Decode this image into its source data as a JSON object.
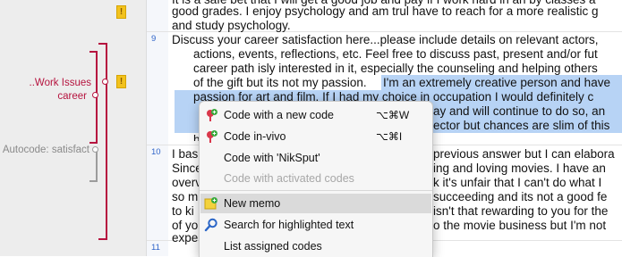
{
  "codes": {
    "parent_label": "..Work Issues",
    "child_label": "career",
    "autocode_label": "Autocode: satisfact",
    "memo_flag_glyph": "!"
  },
  "line_numbers": [
    "9",
    "10",
    "11"
  ],
  "document_lines": [
    "It is a safe bet that I will get a good job and pay if I work hard in an by classes a",
    "good grades. I enjoy psychology and am trul have to reach for a more realistic g",
    "and study psychology.",
    "Discuss your career satisfaction here...please include details on relevant actors,",
    "actions, events, reflections, etc. Feel free to discuss past, present and/or fut",
    "career path isly interested in it, especially the counseling and helping others",
    "of the gift but its not my passion. ",
    "I'm an extremely creative person and have",
    "passion for art and film. If I had my choice in occupation I would definitely c",
    "ay and will continue to do so, an",
    "ector but chances are slim of this",
    "h",
    "I bas",
    "previous answer but I can elabora",
    "Since",
    "ing and loving movies. I have an",
    "overv",
    "k it's unfair that I can't do what I",
    "so m",
    "succeeding and its not a good fe",
    "to ki",
    "isn't that rewarding to you for the",
    "of yo",
    "o the movie business but I'm not",
    "expe"
  ],
  "context_menu": {
    "items": [
      {
        "label": "Code with a new code",
        "shortcut": "⌥⌘W"
      },
      {
        "label": "Code in-vivo",
        "shortcut": "⌥⌘I"
      },
      {
        "label": "Code with 'NikSput'"
      },
      {
        "label": "Code with activated codes"
      },
      {
        "label": "New memo"
      },
      {
        "label": "Search for highlighted text"
      },
      {
        "label": "List assigned codes"
      }
    ]
  },
  "colors": {
    "code_bracket": "#b6143f",
    "autocode_bracket": "#9c9c9c",
    "selection": "#b7d3f5",
    "memo_flag": "#f2c21e",
    "line_number": "#2f64c8"
  }
}
